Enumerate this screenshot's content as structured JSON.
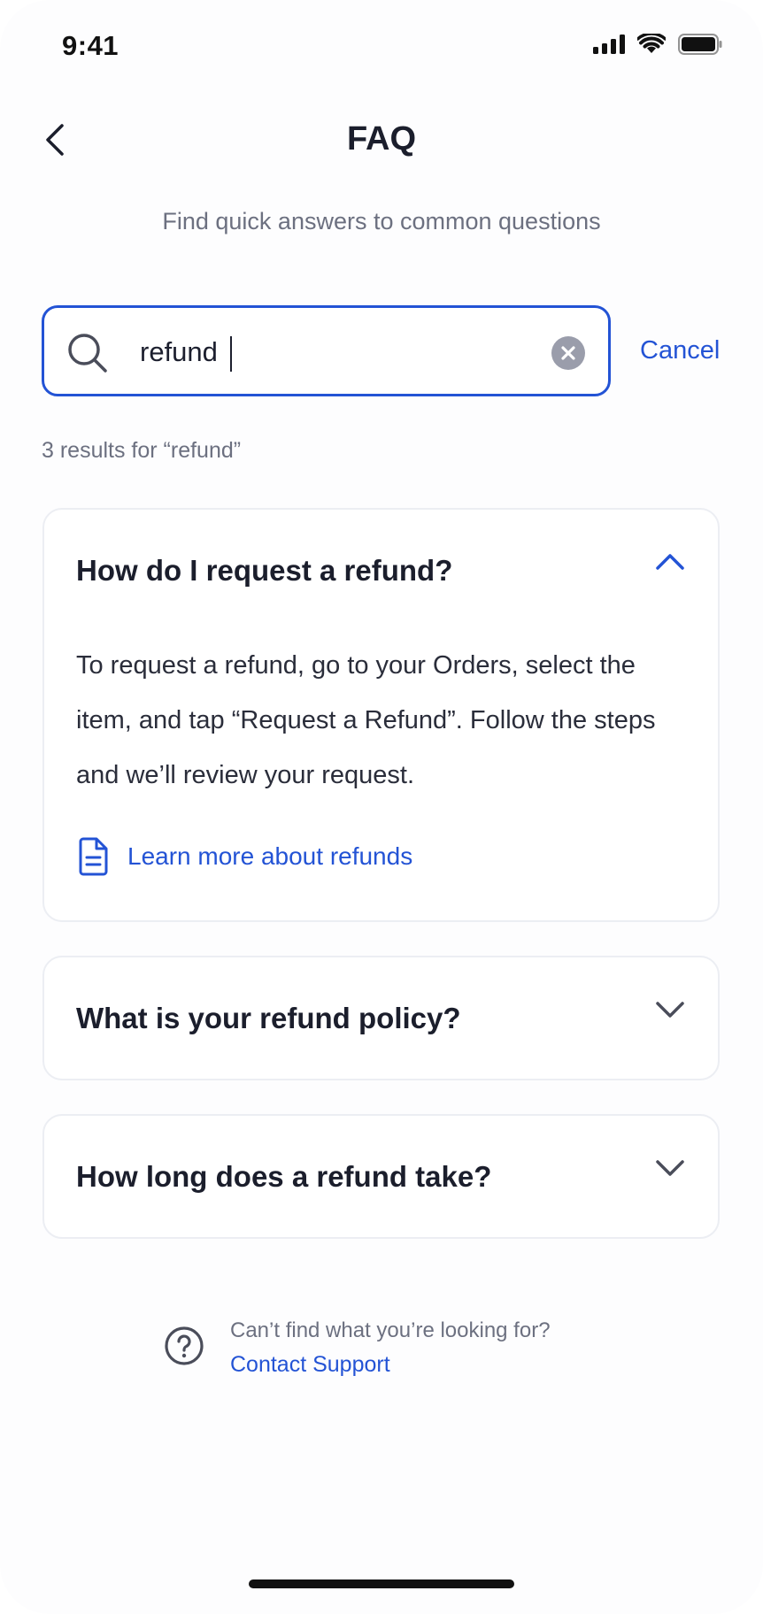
{
  "status_bar": {
    "time": "9:41"
  },
  "header": {
    "title": "FAQ",
    "subtitle": "Find quick answers to common questions"
  },
  "search": {
    "value": "refund",
    "cancel_label": "Cancel"
  },
  "results": {
    "count_text": "3 results for “refund”"
  },
  "faqs": [
    {
      "question": "How do I request a refund?",
      "expanded": true,
      "answer": "To request a refund, go to your Orders, select the item, and tap “Request a Refund”. Follow the steps and we’ll review your request.",
      "link_label": "Learn more about refunds"
    },
    {
      "question": "What is your refund policy?",
      "expanded": false
    },
    {
      "question": "How long does a refund take?",
      "expanded": false
    }
  ],
  "support": {
    "prompt": "Can’t find what you’re looking for?",
    "link_label": "Contact Support"
  },
  "colors": {
    "accent": "#2353d5",
    "text": "#1b1e2c",
    "muted": "#6c7080"
  }
}
